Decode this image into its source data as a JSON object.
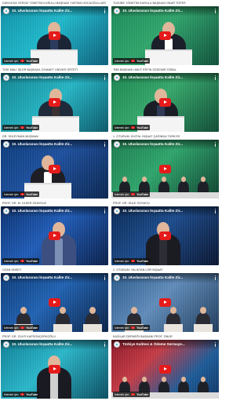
{
  "video_title": "10. Uluslararası İnşaatta Kalite Zir...",
  "watch_on": "İzlemek için:",
  "youtube_label": "YouTube",
  "colors": {
    "play": "#e51b1b",
    "stage_cyan": "#1fb6c9",
    "stage_green": "#2fa36a",
    "stage_blue": "#1d4f9c"
  },
  "videos": [
    {
      "caption": "DÜNYA'DA YERSİZ YÖNETİM KURULU BAŞKANI YURTAN HOCAOĞULLARI",
      "scene": "podium-cyan"
    },
    {
      "caption": "TÜZÜBE YÖNETİM KURULU BAŞKANI ONUR TOPER",
      "scene": "podium-green"
    },
    {
      "caption": "TÜİK MALİ İŞLER BAŞKANI, DİYANET ÜNİVER ÖRTETİ",
      "scene": "speaker-cyan"
    },
    {
      "caption": "TMB BAŞKANI UMUT ERTİN ÖZDEMİR ÖZBAL",
      "scene": "speaker-green"
    },
    {
      "caption": "DR. SÜLEYMAN MUŞMAN",
      "scene": "podium-blue"
    },
    {
      "caption": "1. OTURUM: DİJİTAL İNŞAAT ÇAĞINDA TÜRKİYE",
      "scene": "panel-green"
    },
    {
      "caption": "PROF. DR. M. ÜLKER ÖZAYKUZ",
      "scene": "stage-blue"
    },
    {
      "caption": "PROF. DR. SÜLE ÖZGÜCÜ",
      "scene": "stage-dark"
    },
    {
      "caption": "OZAN ÜNSEY",
      "scene": "armchair-blue"
    },
    {
      "caption": "2. OTURUM: YALIKTAN LÖR İNŞAAT",
      "scene": "armchair-grey"
    },
    {
      "caption": "PROF. DR. ZÜLFİ KAPSONÇERKOĞLU",
      "scene": "stage-cyan"
    },
    {
      "caption": "KASİLAR DERNEĞİ BAŞKANI PROF. ÖNUR",
      "scene": "panel-red"
    }
  ],
  "last_title": "Türkiye Kalitesi & Ödeme Sermaye..."
}
